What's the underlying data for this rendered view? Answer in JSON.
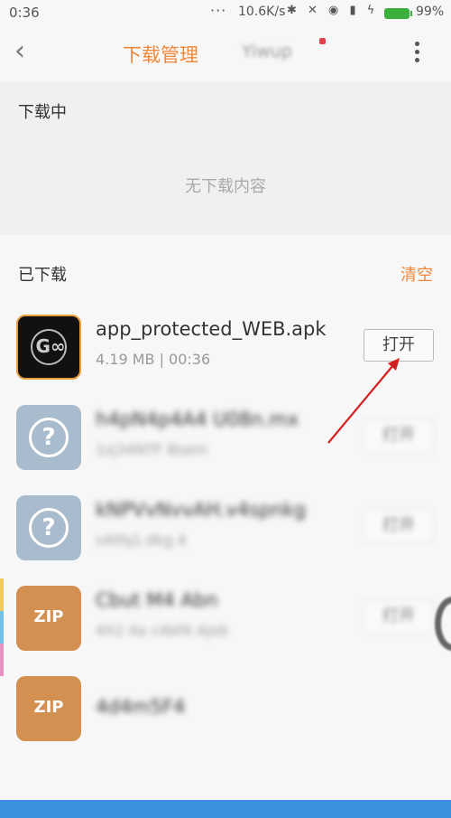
{
  "status": {
    "time": "0:36",
    "dots": "···",
    "speed": "10.6K/s",
    "icons": "✱ ✕ ◉ ▮ ϟ",
    "battery": "99%"
  },
  "header": {
    "back_icon": "‹",
    "title": "下载管理",
    "title2": "Yiwup"
  },
  "downloading": {
    "title": "下载中",
    "empty": "无下载内容"
  },
  "downloaded": {
    "title": "已下载",
    "clear": "清空",
    "items": [
      {
        "name": "app_protected_WEB.apk",
        "meta": "4.19 MB | 00:36",
        "action": "打开",
        "icon": "app-logo-icon",
        "glyph": "G∞"
      },
      {
        "name": "h4pN4p4A4 U08n.mx",
        "meta": "1sj34NTF Bsem",
        "action": "打开",
        "icon": "unknown-file-icon",
        "glyph": "?"
      },
      {
        "name": "kNPVvNvvAH.v4spnkg",
        "meta": "s4tfq1.dkg 4",
        "action": "打开",
        "icon": "unknown-file-icon",
        "glyph": "?"
      },
      {
        "name": "Cbut M4 Abn",
        "meta": "4X2 4a c4bf4 Ajob",
        "action": "打开",
        "icon": "zip-file-icon",
        "glyph": "ZIP"
      },
      {
        "name": "4d4m5F4",
        "meta": "",
        "action": "",
        "icon": "zip-file-icon",
        "glyph": "ZIP"
      }
    ]
  },
  "colors": {
    "accent": "#f0883c",
    "arrow": "#d42020",
    "nav": "#3d8fe0"
  }
}
